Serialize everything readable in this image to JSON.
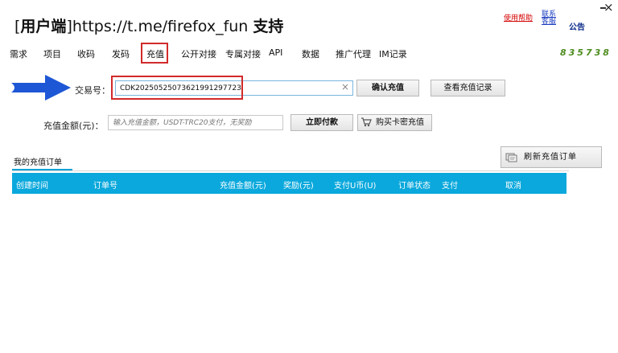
{
  "header": {
    "title_bracket": "[",
    "title_user": "用户端",
    "title_bracket_close": "]",
    "title_url": "https://t.me/firefox_fun",
    "title_support": "支持",
    "help_link": "使用帮助",
    "contact_link": "联系客服",
    "notice": "公告",
    "minimize": "",
    "close": "×"
  },
  "menu": {
    "items": [
      "需求",
      "项目",
      "收码",
      "发码",
      "充值",
      "公开对接",
      "专属对接",
      "API",
      "数据",
      "推广代理",
      "IM记录"
    ],
    "active": "充值",
    "code": "835738"
  },
  "recharge": {
    "txn_label": "交易号：",
    "txn_value": "CDK2025052507362199129772З",
    "confirm_button": "确认充值",
    "view_records_button": "查看充值记录",
    "amount_label": "充值金额(元)：",
    "amount_placeholder": "输入充值金额，USDT-TRC20支付，无奖励",
    "pay_button": "立即付款",
    "buy_card_button": "购买卡密充值"
  },
  "orders": {
    "tab_label": "我的充值订单",
    "refresh_button": "刷新充值订单",
    "columns": [
      "创建时间",
      "订单号",
      "充值金额(元)",
      "奖励(元)",
      "支付U币(U)",
      "订单状态",
      "支付",
      "取消"
    ],
    "rows": []
  },
  "colors": {
    "accent": "#0aa8dc",
    "highlight_red": "#d22a2a",
    "arrow_blue": "#1e57d6",
    "code_green": "#4a8a1a"
  }
}
